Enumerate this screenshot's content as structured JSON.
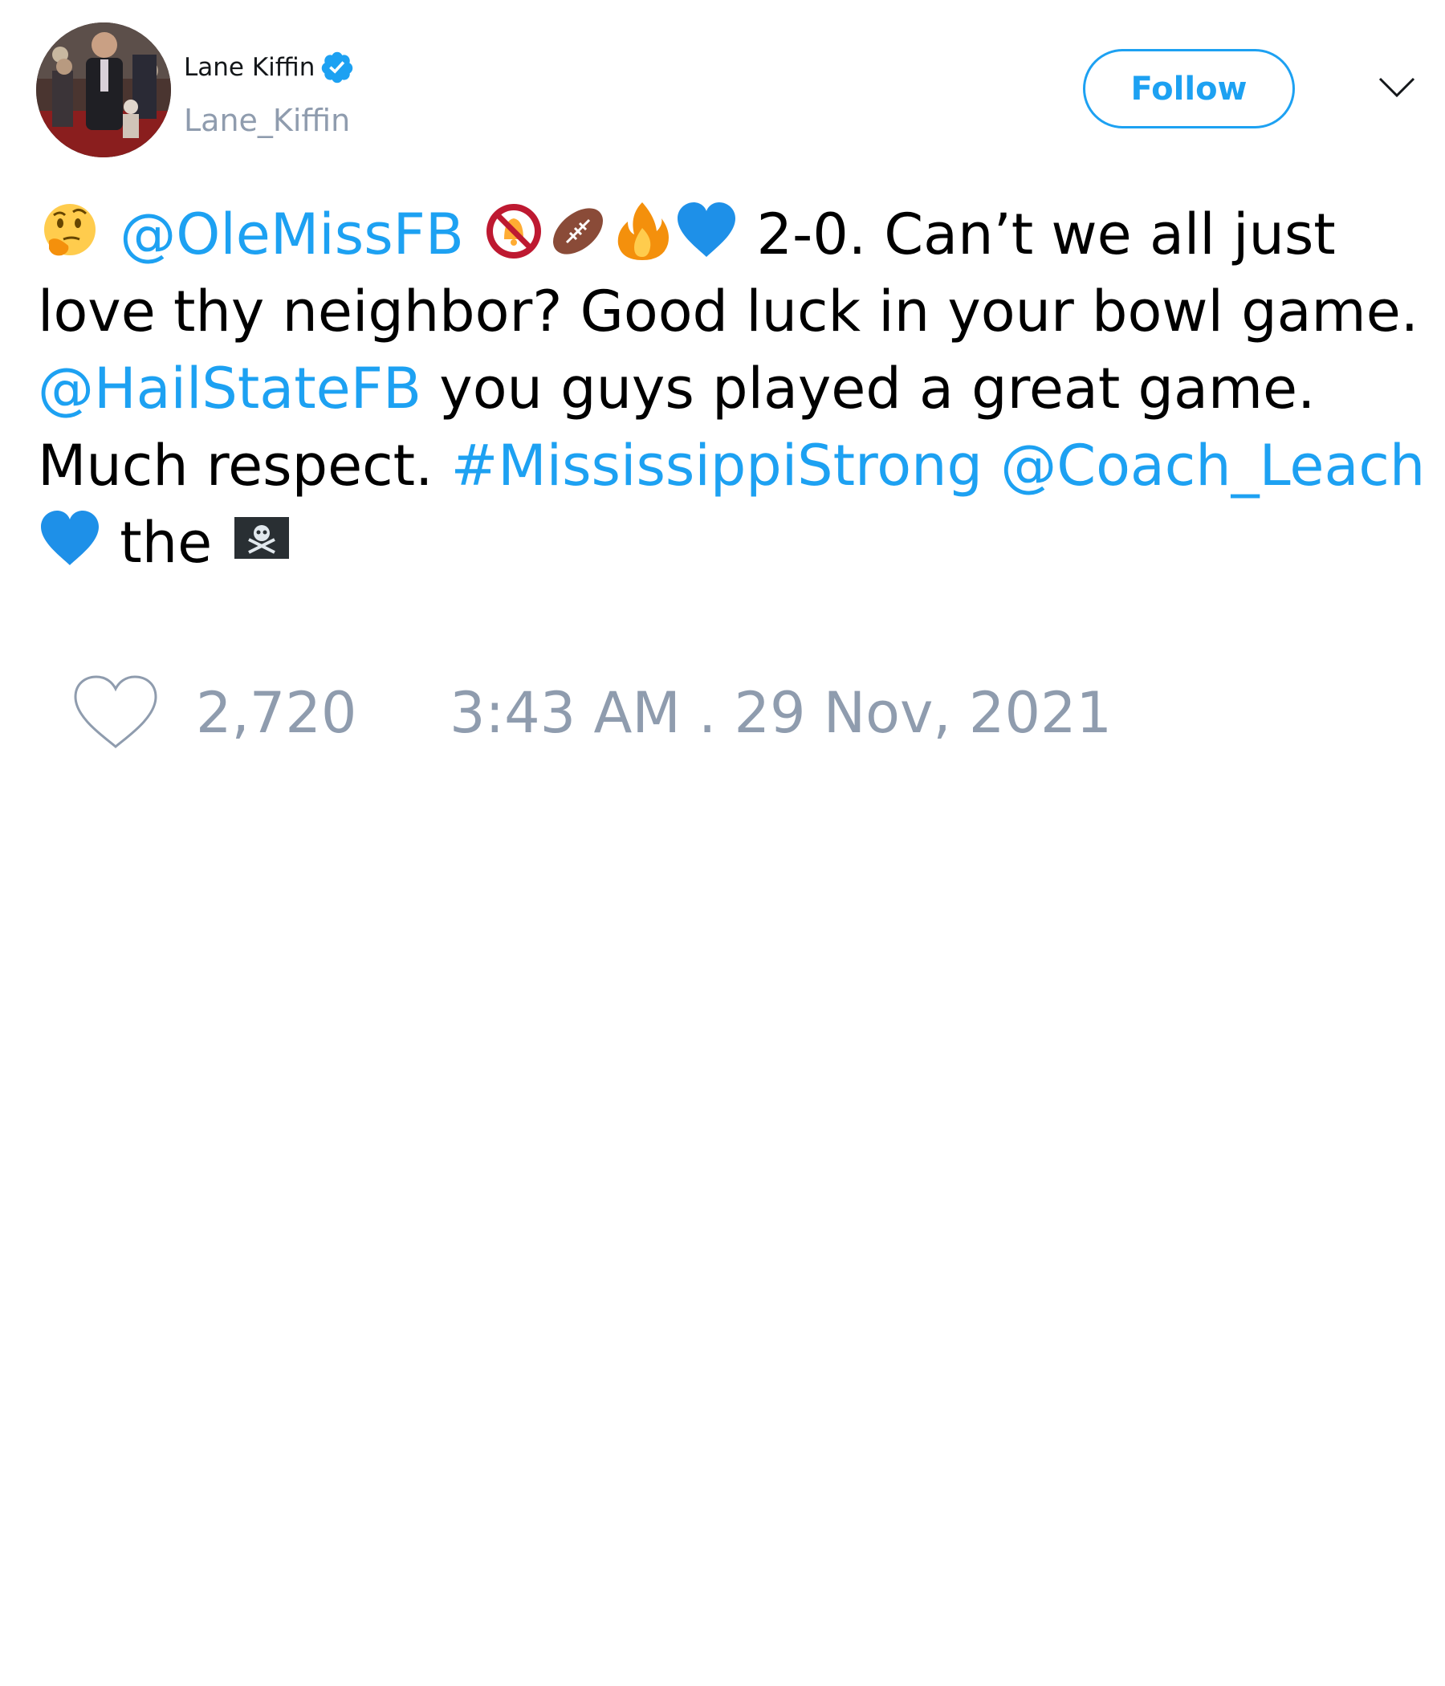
{
  "author": {
    "display_name": "Lane Kiffin",
    "handle": "Lane_Kiffin",
    "verified": true
  },
  "follow_button": {
    "label": "Follow"
  },
  "tweet": {
    "lines": [
      [
        {
          "type": "emoji",
          "name": "thinking-face-emoji"
        },
        {
          "type": "text",
          "value": " "
        },
        {
          "type": "link",
          "value": "@OleMissFB"
        },
        {
          "type": "text",
          "value": " "
        },
        {
          "type": "emoji",
          "name": "no-bell-emoji"
        },
        {
          "type": "emoji",
          "name": "football-emoji"
        },
        {
          "type": "emoji",
          "name": "fire-emoji"
        },
        {
          "type": "emoji",
          "name": "blue-heart-emoji"
        },
        {
          "type": "text",
          "value": " 2-0. Can’t we all just"
        }
      ],
      [
        {
          "type": "text",
          "value": "love thy neighbor? Good luck in your bowl game."
        }
      ],
      [
        {
          "type": "link",
          "value": "@HailStateFB"
        },
        {
          "type": "text",
          "value": " you guys played a great game."
        }
      ],
      [
        {
          "type": "text",
          "value": "Much respect. "
        },
        {
          "type": "link",
          "value": "#MississippiStrong"
        },
        {
          "type": "text",
          "value": " "
        },
        {
          "type": "link",
          "value": "@Coach_Leach"
        }
      ],
      [
        {
          "type": "emoji",
          "name": "blue-heart-emoji"
        },
        {
          "type": "text",
          "value": " the "
        },
        {
          "type": "emoji",
          "name": "pirate-flag-emoji"
        }
      ]
    ]
  },
  "footer": {
    "like_count": "2,720",
    "timestamp": "3:43 AM . 29 Nov, 2021"
  },
  "colors": {
    "link": "#1da1f2",
    "muted": "#8f9cae",
    "text": "#000000"
  },
  "icons": {
    "verified": "verified-badge-icon",
    "menu": "chevron-down-icon",
    "like": "heart-outline-icon"
  }
}
